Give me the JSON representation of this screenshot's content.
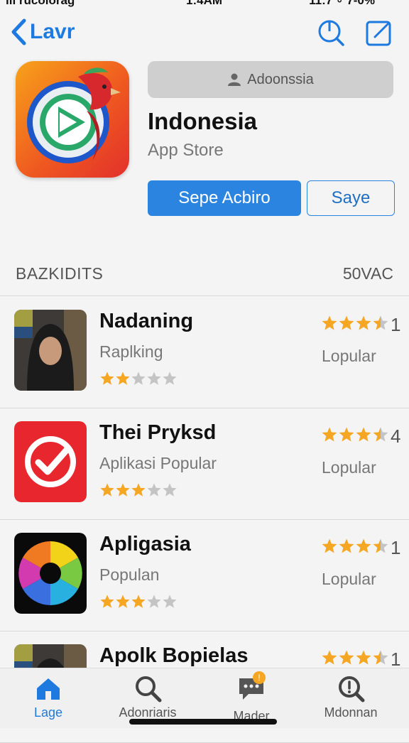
{
  "status_bar": {
    "carrier": "ııı rucolorag",
    "time": "1:4AM",
    "battery": "11:7 ∘ 7-0%"
  },
  "nav": {
    "back_label": "Lavr"
  },
  "app": {
    "badge_label": "Adoonssia",
    "title": "Indonesia",
    "subtitle": "App Store",
    "primary_button": "Sepe Acbiro",
    "secondary_button": "Saye"
  },
  "section": {
    "left": "BAZKIDITS",
    "right": "50VAC"
  },
  "items": [
    {
      "title": "Nadaning",
      "subtitle": "Raplking",
      "rating_right": 3.5,
      "count": "1",
      "right_label": "Lopular",
      "rating_small": 2,
      "thumb": "portrait"
    },
    {
      "title": "Thei Pryksd",
      "subtitle": "Aplikasi Popular",
      "rating_right": 3.5,
      "count": "4",
      "right_label": "Lopular",
      "rating_small": 3,
      "thumb": "check"
    },
    {
      "title": "Apligasia",
      "subtitle": "Populan",
      "rating_right": 3.5,
      "count": "1",
      "right_label": "Lopular",
      "rating_small": 3,
      "thumb": "wheel"
    },
    {
      "title": "Apolk Bopielas",
      "subtitle": "",
      "rating_right": 3.5,
      "count": "1",
      "right_label": "",
      "rating_small": 0,
      "thumb": "portrait"
    }
  ],
  "tabs": [
    {
      "label": "Lage",
      "icon": "home-icon",
      "active": true
    },
    {
      "label": "Adonriaris",
      "icon": "search-icon",
      "active": false
    },
    {
      "label": "Mader",
      "icon": "chat-icon",
      "active": false,
      "badge": "!"
    },
    {
      "label": "Mdonnan",
      "icon": "search-alert-icon",
      "active": false
    }
  ],
  "colors": {
    "accent": "#2b85e0",
    "star": "#f5a623",
    "star_empty": "#c4c4c4"
  }
}
